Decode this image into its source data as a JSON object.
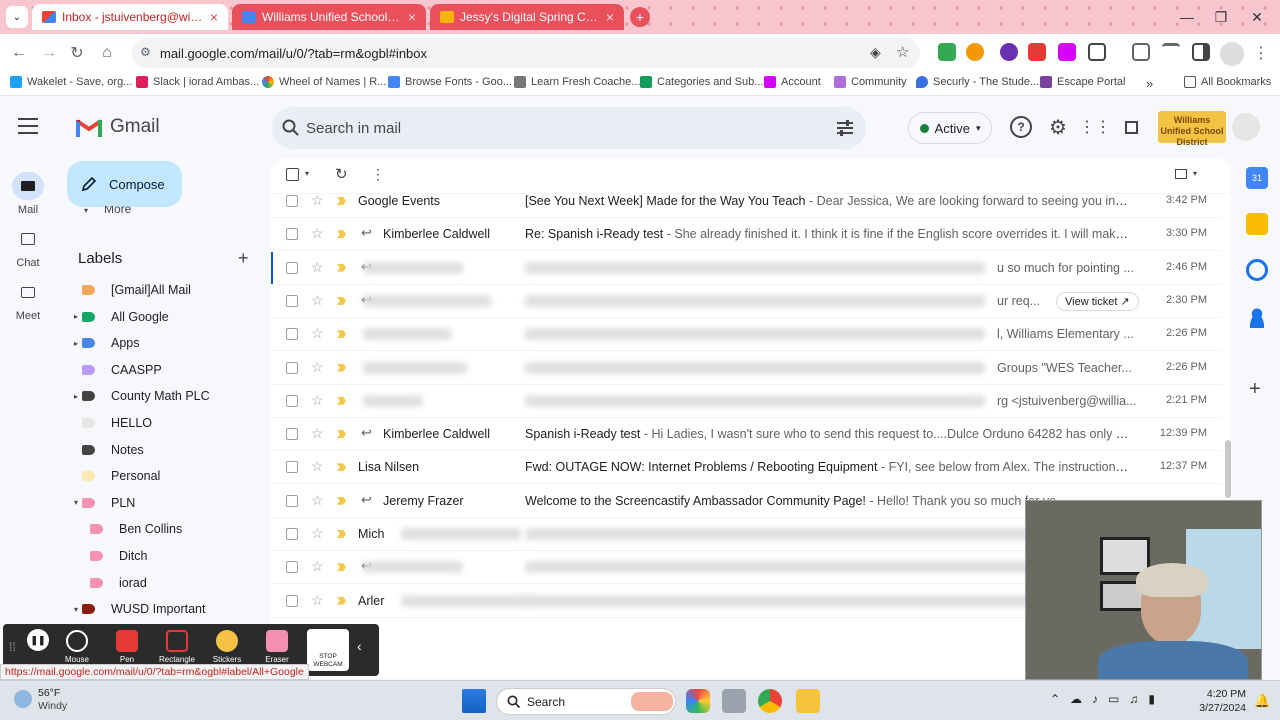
{
  "browser": {
    "tabs": [
      {
        "label": "Inbox - jstuivenberg@williams",
        "active": true
      },
      {
        "label": "Williams Unified School District",
        "active": false
      },
      {
        "label": "Jessy's Digital Spring Cleaning",
        "active": false
      }
    ],
    "url": "mail.google.com/mail/u/0/?tab=rm&ogbl#inbox",
    "bookmarks": [
      "Wakelet - Save, org...",
      "Slack | iorad Ambas...",
      "Wheel of Names | R...",
      "Browse Fonts - Goo...",
      "Learn Fresh Coache...",
      "Categories and Sub...",
      "Account",
      "Community",
      "Securly - The Stude...",
      "Escape Portal"
    ],
    "all_bookmarks": "All Bookmarks",
    "status_url": "https://mail.google.com/mail/u/0/?tab=rm&ogbl#label/All+Google"
  },
  "gmail": {
    "brand": "Gmail",
    "search_placeholder": "Search in mail",
    "status": "Active",
    "org_logo_text": "Williams Unified School District",
    "compose": "Compose",
    "rail": {
      "mail": "Mail",
      "chat": "Chat",
      "meet": "Meet"
    },
    "more": "More",
    "labels_title": "Labels",
    "labels": [
      {
        "name": "[Gmail]All Mail",
        "color": "#f2a65a",
        "caret": ""
      },
      {
        "name": "All Google",
        "color": "#16a765",
        "caret": "▸"
      },
      {
        "name": "Apps",
        "color": "#4a86e8",
        "caret": "▸"
      },
      {
        "name": "CAASPP",
        "color": "#b99aff",
        "caret": ""
      },
      {
        "name": "County Math PLC",
        "color": "#434343",
        "caret": "▸"
      },
      {
        "name": "HELLO",
        "color": "#e6e6e6",
        "caret": ""
      },
      {
        "name": "Notes",
        "color": "#434343",
        "caret": ""
      },
      {
        "name": "Personal",
        "color": "#fce8b3",
        "caret": ""
      },
      {
        "name": "PLN",
        "color": "#f691b2",
        "caret": "▾"
      },
      {
        "name": "Ben Collins",
        "color": "#f691b2",
        "caret": "",
        "sub": true
      },
      {
        "name": "Ditch",
        "color": "#f691b2",
        "caret": "",
        "sub": true
      },
      {
        "name": "iorad",
        "color": "#f691b2",
        "caret": "",
        "sub": true
      },
      {
        "name": "WUSD Important",
        "color": "#8a1c0a",
        "caret": "▾"
      }
    ],
    "emails": [
      {
        "sender": "Google Events",
        "subject": "[See You Next Week] Made for the Way You Teach",
        "preview": " - Dear Jessica, We are looking forward to seeing you in one we...",
        "time": "3:42 PM",
        "replied": false
      },
      {
        "sender": "Kimberlee Caldwell",
        "subject": "Re: Spanish i-Ready test",
        "preview": " - She already finished it. I think it is fine if the English score overrides it. I will make a co...",
        "time": "3:30 PM",
        "replied": true
      },
      {
        "sender": "",
        "subject": "",
        "preview": "u so much for pointing ...",
        "time": "2:46 PM",
        "replied": true,
        "blurred": true
      },
      {
        "sender": "",
        "subject": "",
        "preview": "ur req...",
        "time": "2:30 PM",
        "replied": true,
        "blurred": true,
        "chip": "View ticket ↗"
      },
      {
        "sender": "",
        "subject": "",
        "preview": "l, Williams Elementary ...",
        "time": "2:26 PM",
        "replied": false,
        "blurred": true
      },
      {
        "sender": "",
        "subject": "",
        "preview": "Groups \"WES Teacher...",
        "time": "2:26 PM",
        "replied": false,
        "blurred": true
      },
      {
        "sender": "",
        "subject": "",
        "preview": "rg <jstuivenberg@willia...",
        "time": "2:21 PM",
        "replied": false,
        "blurred": true
      },
      {
        "sender": "Kimberlee Caldwell",
        "subject": "Spanish i-Ready test",
        "preview": " - Hi Ladies, I wasn't sure who to send this request to....Dulce Orduno 64282 has only been ...",
        "time": "12:39 PM",
        "replied": true
      },
      {
        "sender": "Lisa Nilsen",
        "subject": "Fwd: OUTAGE NOW: Internet Problems / Rebooting Equipment",
        "preview": " - FYI, see below from Alex. The instructional netw...",
        "time": "12:37 PM",
        "replied": false
      },
      {
        "sender": "Jeremy Frazer",
        "subject": "Welcome to the Screencastify Ambassador Community Page!",
        "preview": " - Hello! Thank you so much for yo",
        "time": "",
        "replied": true
      },
      {
        "sender": "Mich",
        "subject": "",
        "preview": "",
        "time": "",
        "replied": false,
        "blurred": true
      },
      {
        "sender": "",
        "subject": "",
        "preview": "",
        "time": "",
        "replied": true,
        "blurred": true
      },
      {
        "sender": "Arler",
        "subject": "",
        "preview": "",
        "time": "",
        "replied": false,
        "blurred": true
      }
    ]
  },
  "screencastify": {
    "tools": [
      "Mouse",
      "Pen",
      "Rectangle",
      "Stickers",
      "Eraser"
    ],
    "stop_webcam": "STOP WEBCAM"
  },
  "taskbar": {
    "temp": "56°F",
    "weather": "Windy",
    "search": "Search",
    "time": "4:20 PM",
    "date": "3/27/2024"
  }
}
